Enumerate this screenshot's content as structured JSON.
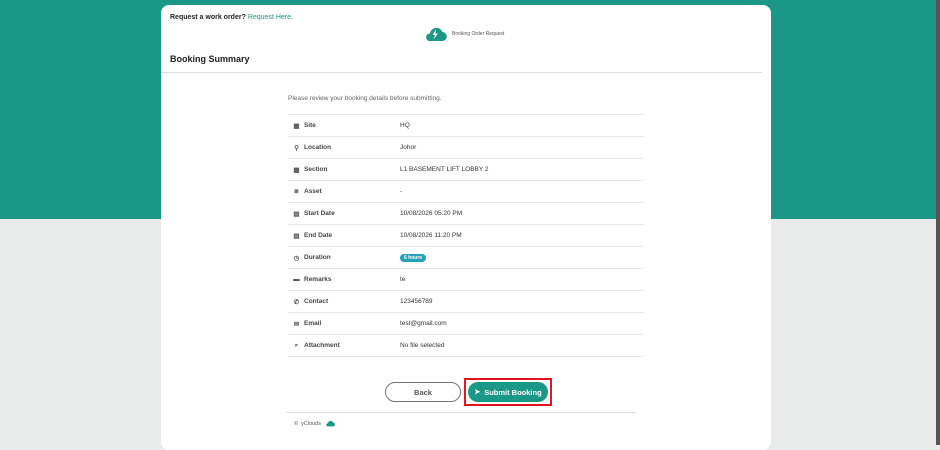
{
  "header": {
    "request_prompt": "Request a work order?",
    "request_link": "Request Here.",
    "brand_label": "Booking Order Request"
  },
  "summary": {
    "title": "Booking Summary",
    "note": "Please review your booking details before submitting.",
    "rows": [
      {
        "icon": "building-icon",
        "label": "Site",
        "value": "HQ"
      },
      {
        "icon": "map-pin-icon",
        "label": "Location",
        "value": "Johor"
      },
      {
        "icon": "grid-icon",
        "label": "Section",
        "value": "L1 BASEMENT LIFT LOBBY 2"
      },
      {
        "icon": "cubes-icon",
        "label": "Asset",
        "value": "-"
      },
      {
        "icon": "calendar-icon",
        "label": "Start Date",
        "value": "10/08/2026 05:20 PM"
      },
      {
        "icon": "calendar-icon",
        "label": "End Date",
        "value": "10/08/2026 11:20 PM"
      },
      {
        "icon": "clock-icon",
        "label": "Duration",
        "value": "6 hours"
      },
      {
        "icon": "note-icon",
        "label": "Remarks",
        "value": "te"
      },
      {
        "icon": "phone-icon",
        "label": "Contact",
        "value": "123456789"
      },
      {
        "icon": "envelope-icon",
        "label": "Email",
        "value": "test@gmail.com"
      },
      {
        "icon": "paperclip-icon",
        "label": "Attachment",
        "value": "No file selected"
      }
    ]
  },
  "actions": {
    "back_label": "Back",
    "submit_label": "Submit Booking"
  },
  "footer": {
    "copyright_symbol": "©",
    "brand": "yClouds"
  },
  "colors": {
    "primary": "#1a9786",
    "badge": "#23a0b8",
    "highlight": "#e2141e"
  }
}
